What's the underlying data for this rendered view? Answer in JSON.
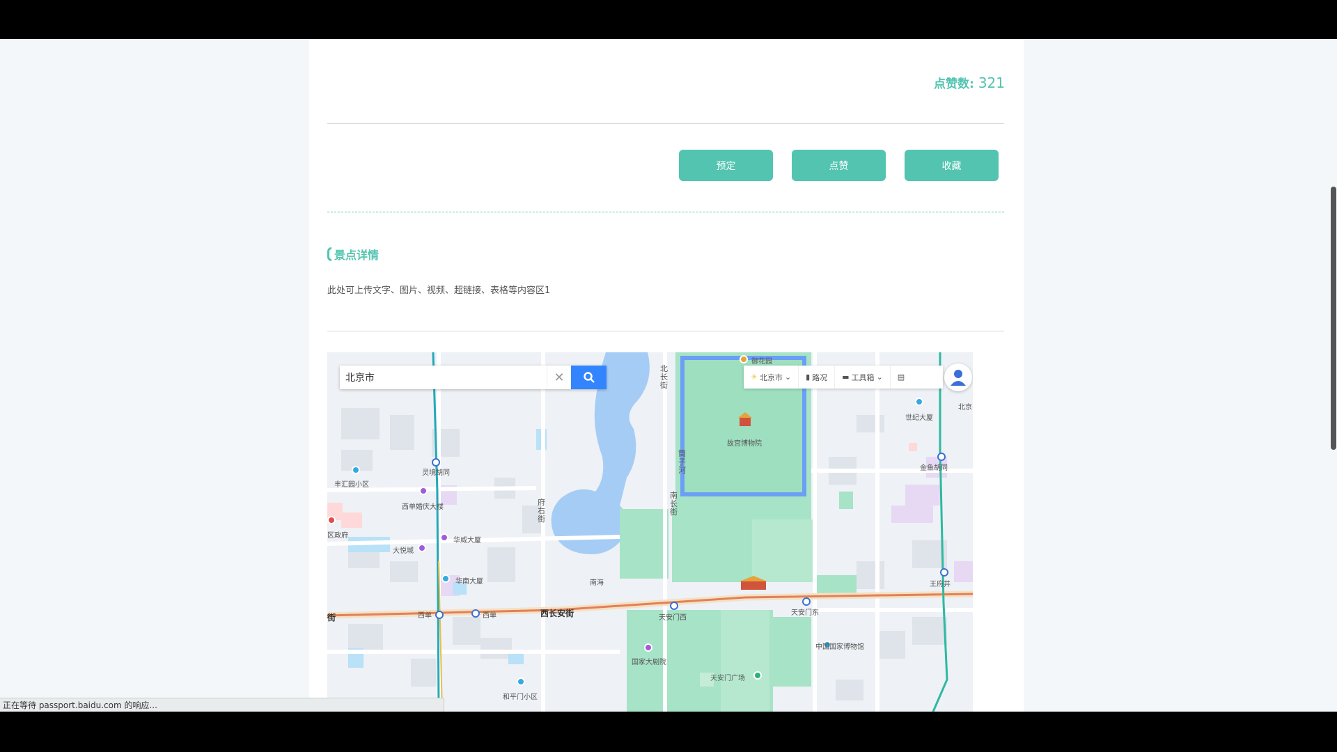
{
  "likes": {
    "label": "点赞数:",
    "value": "321"
  },
  "buttons": {
    "book": "预定",
    "like": "点赞",
    "favorite": "收藏"
  },
  "section": {
    "title": "景点详情",
    "content": "此处可上传文字、图片、视频、超链接、表格等内容区1"
  },
  "map": {
    "search_value": "北京市",
    "toolbar": {
      "city": "北京市",
      "traffic": "路况",
      "tools": "工具箱"
    },
    "labels": {
      "yuhuayuan": "御花园",
      "gugong": "故宫博物院",
      "shijidasha": "世纪大厦",
      "jinyuhutong": "金鱼胡同",
      "lingjinghutong": "灵境胡同",
      "fenghuiyuan": "丰汇园小区",
      "xidanhunqing": "西单婚庆大楼",
      "quzhengfu": "区政府",
      "huaweidasha": "华威大厦",
      "dayuecheng": "大悦城",
      "huanandasha": "华南大厦",
      "nanhai": "南海",
      "wangfujing": "王府井",
      "xidan1": "西单",
      "xidan2": "西单",
      "xichanganjie": "西长安街",
      "tiananmenxi": "天安门西",
      "tiananmendong": "天安门东",
      "guojiabowuguan": "中国国家博物馆",
      "guojiadajuyuan": "国家大剧院",
      "tiananmenguangchang": "天安门广场",
      "hepingmen": "和平门小区",
      "beichangjie": "北长街",
      "nanchangjie": "南长街",
      "fuyoujie": "府右街",
      "chizihe": "筒子河",
      "beijing_edge": "北京",
      "jie": "街"
    }
  },
  "status_text": "正在等待 passport.baidu.com 的响应..."
}
